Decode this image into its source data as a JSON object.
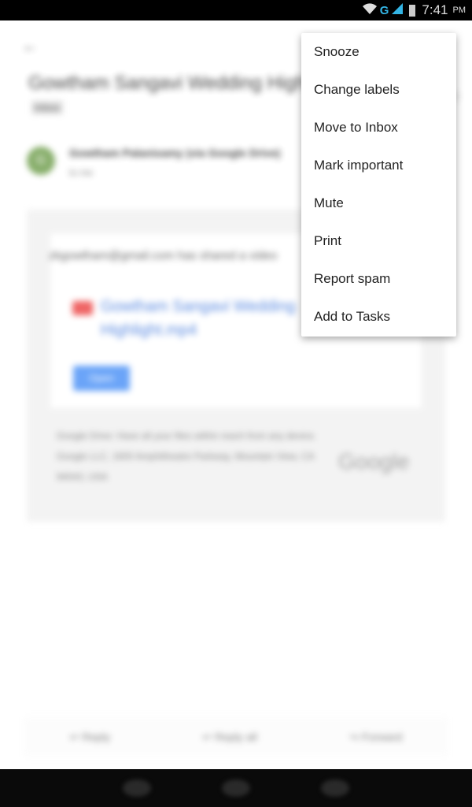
{
  "status_bar": {
    "time": "7:41",
    "ampm": "PM",
    "network": "G"
  },
  "email": {
    "back_icon": "arrow-left-icon",
    "subject": "Gowtham Sangavi Wedding Highlights video",
    "label": "Inbox",
    "avatar_letter": "G",
    "sender": "Gowtham Palanisamy (via Google Drive)",
    "recipient": "to me",
    "shared_text": "zkgowtham@gmail.com has shared a video",
    "file_name": "Gowtham Sangavi Wedding Highlight.mp4",
    "open_label": "Open",
    "footer_line1": "Google Drive: Have all your files within reach from any device.",
    "footer_line2": "Google LLC, 1600 Amphitheatre Parkway, Mountain View, CA 94043, USA",
    "footer_logo": "Google"
  },
  "actions": {
    "reply": "Reply",
    "reply_all": "Reply all",
    "forward": "Forward"
  },
  "menu": {
    "items": [
      "Snooze",
      "Change labels",
      "Move to Inbox",
      "Mark important",
      "Mute",
      "Print",
      "Report spam",
      "Add to Tasks"
    ]
  }
}
